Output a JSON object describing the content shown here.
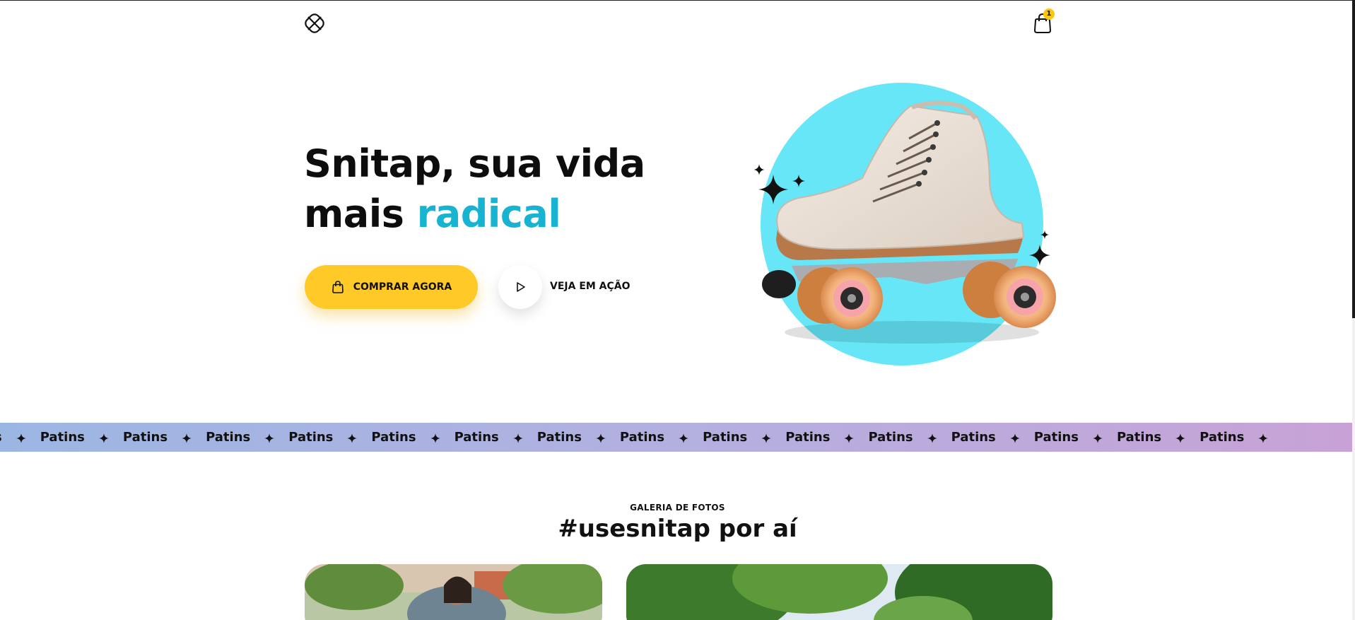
{
  "header": {
    "logo_icon": "snitap-logo-icon",
    "cart_icon": "shopping-bag-icon",
    "cart_count": "1"
  },
  "hero": {
    "title_line1": "Snitap, sua vida",
    "title_line2_plain": "mais ",
    "title_line2_accent": "radical",
    "buy_button": "COMPRAR AGORA",
    "play_label": "VEJA EM AÇÃO",
    "image_icon": "roller-skate-image"
  },
  "marquee": {
    "word": "Patins",
    "separator_icon": "four-point-star-icon"
  },
  "gallery": {
    "kicker": "GALERIA DE FOTOS",
    "title": "#usesnitap por aí"
  },
  "colors": {
    "accent_cyan": "#19b3d2",
    "button_yellow": "#ffc928",
    "circle_cyan": "#66e6f7",
    "marquee_start": "#9cb6e3",
    "marquee_end": "#c8a2d6"
  }
}
